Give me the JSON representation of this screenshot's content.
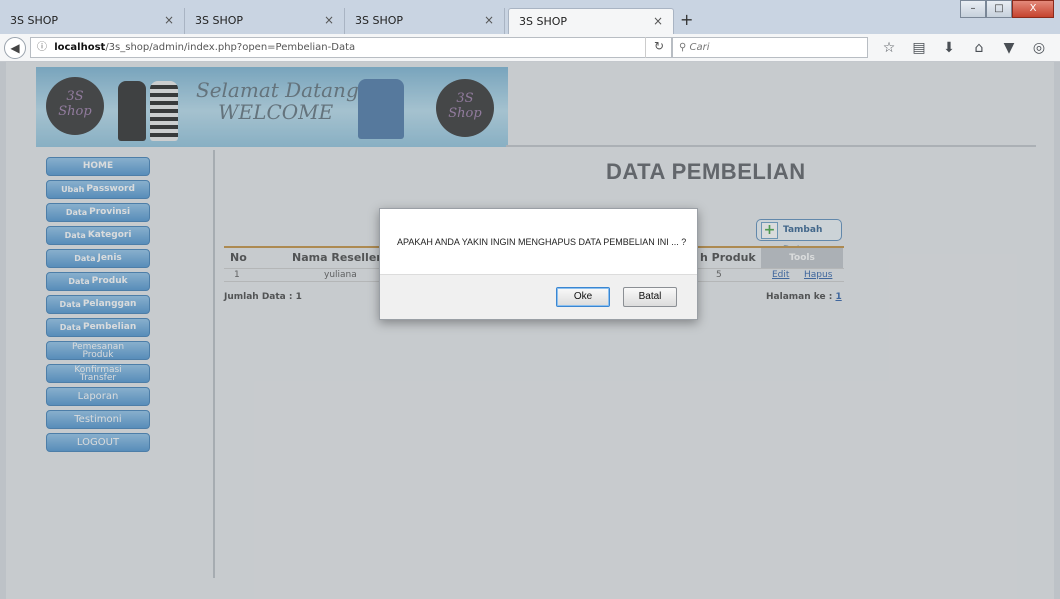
{
  "browser": {
    "tabs": [
      {
        "title": "3S SHOP",
        "active": false
      },
      {
        "title": "3S SHOP",
        "active": false
      },
      {
        "title": "3S SHOP",
        "active": false
      },
      {
        "title": "3S SHOP",
        "active": true
      }
    ],
    "tab_close": "×",
    "new_tab": "+",
    "url_host": "localhost",
    "url_path": "/3s_shop/admin/index.php?open=Pembelian-Data",
    "search_placeholder": "Cari",
    "window_buttons": {
      "minimize": "–",
      "maximize": "□",
      "close": "X"
    }
  },
  "banner": {
    "logo_left": "3S\nShop",
    "logo_text_top": "3S",
    "logo_text_bottom": "Shop",
    "greeting_line1": "Selamat Datang",
    "greeting_line2": "WELCOME",
    "logo_right_top": "3S",
    "logo_right_bottom": "Shop"
  },
  "sidebar": {
    "items": [
      {
        "pre": "",
        "label": "HOME"
      },
      {
        "pre": "Ubah",
        "label": "Password"
      },
      {
        "pre": "Data",
        "label": "Provinsi"
      },
      {
        "pre": "Data",
        "label": "Kategori"
      },
      {
        "pre": "Data",
        "label": "Jenis"
      },
      {
        "pre": "Data",
        "label": "Produk"
      },
      {
        "pre": "Data",
        "label": "Pelanggan"
      },
      {
        "pre": "Data",
        "label": "Pembelian"
      },
      {
        "line1": "Pemesanan",
        "line2": "Produk"
      },
      {
        "line1": "Konfirmasi",
        "line2": "Transfer"
      },
      {
        "label": "Laporan"
      },
      {
        "label": "Testimoni"
      },
      {
        "label": "LOGOUT"
      }
    ]
  },
  "content": {
    "title": "DATA PEMBELIAN",
    "add_button": "Tambah Data",
    "columns": {
      "no": "No",
      "reseller": "Nama Reseller",
      "jumlah_produk": "h Produk",
      "tools": "Tools"
    },
    "row": {
      "no": "1",
      "reseller": "yuliana",
      "jumlah": "5",
      "edit": "Edit",
      "delete": "Hapus"
    },
    "footer_count": "Jumlah Data : 1",
    "footer_page_label": "Halaman ke : ",
    "footer_page_link": "1"
  },
  "dialog": {
    "message": "APAKAH ANDA YAKIN INGIN MENGHAPUS DATA PEMBELIAN INI ... ?",
    "ok": "Oke",
    "cancel": "Batal"
  },
  "colors": {
    "menu_blue": "#4d93cf",
    "table_rule": "#c38f3f",
    "link": "#2b5fa8"
  }
}
